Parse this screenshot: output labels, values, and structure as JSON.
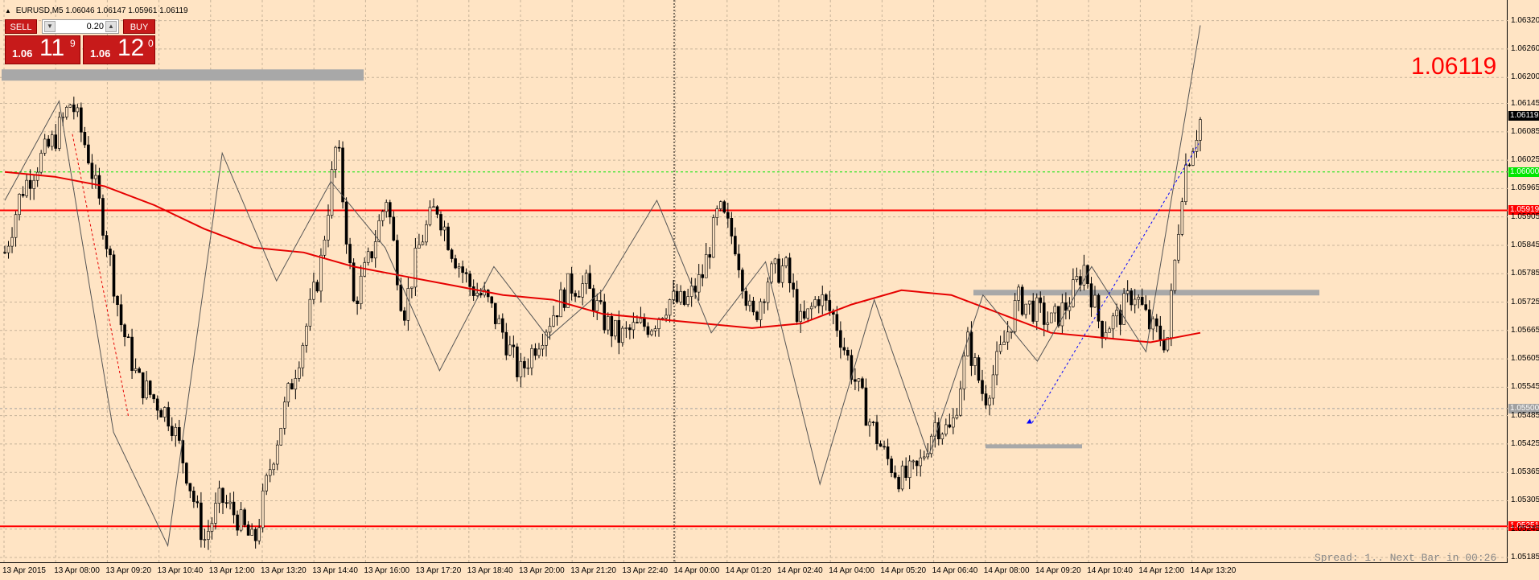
{
  "header": {
    "symbol": "EURUSD,M5",
    "ohlc": "1.06046 1.06147 1.05961 1.06119"
  },
  "trade_panel": {
    "sell_label": "SELL",
    "buy_label": "BUY",
    "lot_value": "0.20",
    "sell_price_prefix": "1.06",
    "sell_price_big": "11",
    "sell_price_sup": "9",
    "buy_price_prefix": "1.06",
    "buy_price_big": "12",
    "buy_price_sup": "0"
  },
  "current_price_display": "1.06119",
  "spread_info": "Spread: 1.. Next Bar in 00:26",
  "price_axis": {
    "labels": [
      "1.06320",
      "1.06260",
      "1.06200",
      "1.06145",
      "1.06085",
      "1.06025",
      "1.05965",
      "1.05905",
      "1.05845",
      "1.05785",
      "1.05725",
      "1.05665",
      "1.05605",
      "1.05545",
      "1.05485",
      "1.05425",
      "1.05365",
      "1.05305",
      "1.05245",
      "1.05185"
    ],
    "tags": {
      "current": "1.06119",
      "green_line": "1.06000",
      "resistance": "1.05919",
      "grey_line": "1.05500",
      "support": "1.05251"
    }
  },
  "time_axis": {
    "labels": [
      "13 Apr 2015",
      "13 Apr 08:00",
      "13 Apr 09:20",
      "13 Apr 10:40",
      "13 Apr 12:00",
      "13 Apr 13:20",
      "13 Apr 14:40",
      "13 Apr 16:00",
      "13 Apr 17:20",
      "13 Apr 18:40",
      "13 Apr 20:00",
      "13 Apr 21:20",
      "13 Apr 22:40",
      "14 Apr 00:00",
      "14 Apr 01:20",
      "14 Apr 02:40",
      "14 Apr 04:00",
      "14 Apr 05:20",
      "14 Apr 06:40",
      "14 Apr 08:00",
      "14 Apr 09:20",
      "14 Apr 10:40",
      "14 Apr 12:00",
      "14 Apr 13:20"
    ]
  },
  "chart_data": {
    "type": "candlestick",
    "symbol": "EURUSD",
    "timeframe": "M5",
    "ylim": [
      1.0518,
      1.0635
    ],
    "grid": true,
    "horizontal_lines": [
      {
        "name": "green-level",
        "value": 1.06,
        "color": "#00e600",
        "style": "dotted"
      },
      {
        "name": "resistance-level",
        "value": 1.05919,
        "color": "#ff0000",
        "style": "solid"
      },
      {
        "name": "support-level",
        "value": 1.05251,
        "color": "#ff0000",
        "style": "solid"
      },
      {
        "name": "grey-level",
        "value": 1.055,
        "color": "#a0a0a0",
        "style": "dotted"
      }
    ],
    "zones": [
      {
        "name": "top-left-zone",
        "value": 1.06205,
        "color": "#a8a8a8"
      },
      {
        "name": "middle-right-zone",
        "value": 1.05745,
        "color": "#a8a8a8"
      },
      {
        "name": "lower-zone",
        "value": 1.0542,
        "color": "#a8a8a8"
      }
    ],
    "price_path": [
      1.0583,
      1.0596,
      1.0602,
      1.0607,
      1.0615,
      1.0604,
      1.0588,
      1.0568,
      1.0556,
      1.0552,
      1.0548,
      1.0536,
      1.0522,
      1.0531,
      1.0527,
      1.0521,
      1.0538,
      1.0552,
      1.0565,
      1.058,
      1.0607,
      1.0572,
      1.0582,
      1.0595,
      1.057,
      1.0585,
      1.0593,
      1.0583,
      1.0576,
      1.0573,
      1.0566,
      1.0557,
      1.0564,
      1.057,
      1.0576,
      1.0576,
      1.0569,
      1.0565,
      1.0567,
      1.0568,
      1.0573,
      1.0572,
      1.0578,
      1.0592,
      1.0585,
      1.0568,
      1.0578,
      1.058,
      1.0567,
      1.0574,
      1.0569,
      1.0558,
      1.0548,
      1.054,
      1.0535,
      1.0537,
      1.0547,
      1.0545,
      1.0564,
      1.0552,
      1.0562,
      1.0573,
      1.0571,
      1.0568,
      1.0572,
      1.058,
      1.0567,
      1.0569,
      1.0575,
      1.0567,
      1.0564,
      1.06,
      1.0611
    ],
    "moving_average": [
      1.06,
      1.0599,
      1.0597,
      1.0593,
      1.0588,
      1.0584,
      1.0583,
      1.058,
      1.0578,
      1.0576,
      1.0574,
      1.0573,
      1.057,
      1.0569,
      1.0568,
      1.0567,
      1.0568,
      1.0572,
      1.0575,
      1.0574,
      1.057,
      1.0566,
      1.0565,
      1.0564,
      1.0566
    ],
    "zigzag": [
      1.0594,
      1.0615,
      1.0545,
      1.0521,
      1.0604,
      1.0577,
      1.0598,
      1.0584,
      1.0558,
      1.058,
      1.0565,
      1.0575,
      1.0594,
      1.0566,
      1.0581,
      1.0534,
      1.0573,
      1.054,
      1.0574,
      1.056,
      1.058,
      1.0562,
      1.0631
    ]
  }
}
